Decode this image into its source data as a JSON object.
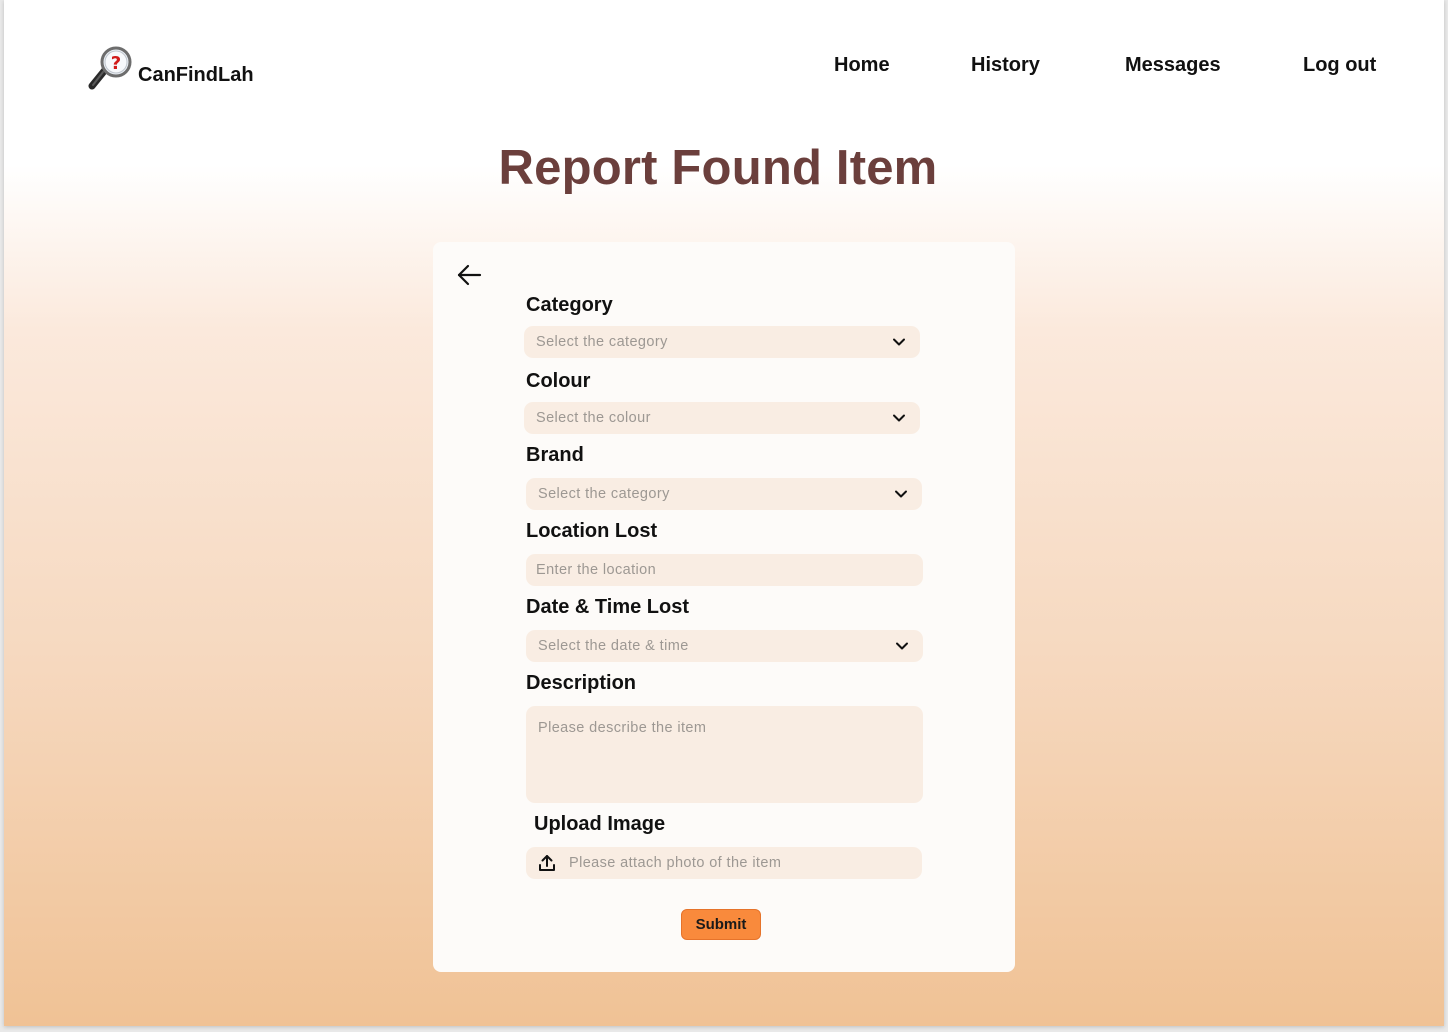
{
  "app": {
    "brand_name": "CanFindLah"
  },
  "nav": {
    "items": [
      {
        "label": "Home"
      },
      {
        "label": "History"
      },
      {
        "label": "Messages"
      },
      {
        "label": "Log out"
      }
    ]
  },
  "page": {
    "title": "Report Found Item"
  },
  "form": {
    "category": {
      "label": "Category",
      "placeholder": "Select the category"
    },
    "colour": {
      "label": "Colour",
      "placeholder": "Select the colour"
    },
    "brand": {
      "label": "Brand",
      "placeholder": "Select the category"
    },
    "location": {
      "label": "Location Lost",
      "placeholder": "Enter the location"
    },
    "datetime": {
      "label": "Date & Time Lost",
      "placeholder": "Select the date & time"
    },
    "description": {
      "label": "Description",
      "placeholder": "Please describe the item"
    },
    "upload": {
      "label": "Upload Image",
      "placeholder": "Please attach photo of the item"
    },
    "submit_label": "Submit"
  },
  "icons": {
    "logo": "magnifying-glass-question-icon",
    "back": "arrow-left-icon",
    "dropdown": "chevron-down-icon",
    "upload": "upload-icon"
  },
  "colors": {
    "title": "#6b3f3c",
    "accent": "#f98a3c",
    "field_bg": "#f9ede3",
    "card_bg": "#fdfbf9"
  }
}
